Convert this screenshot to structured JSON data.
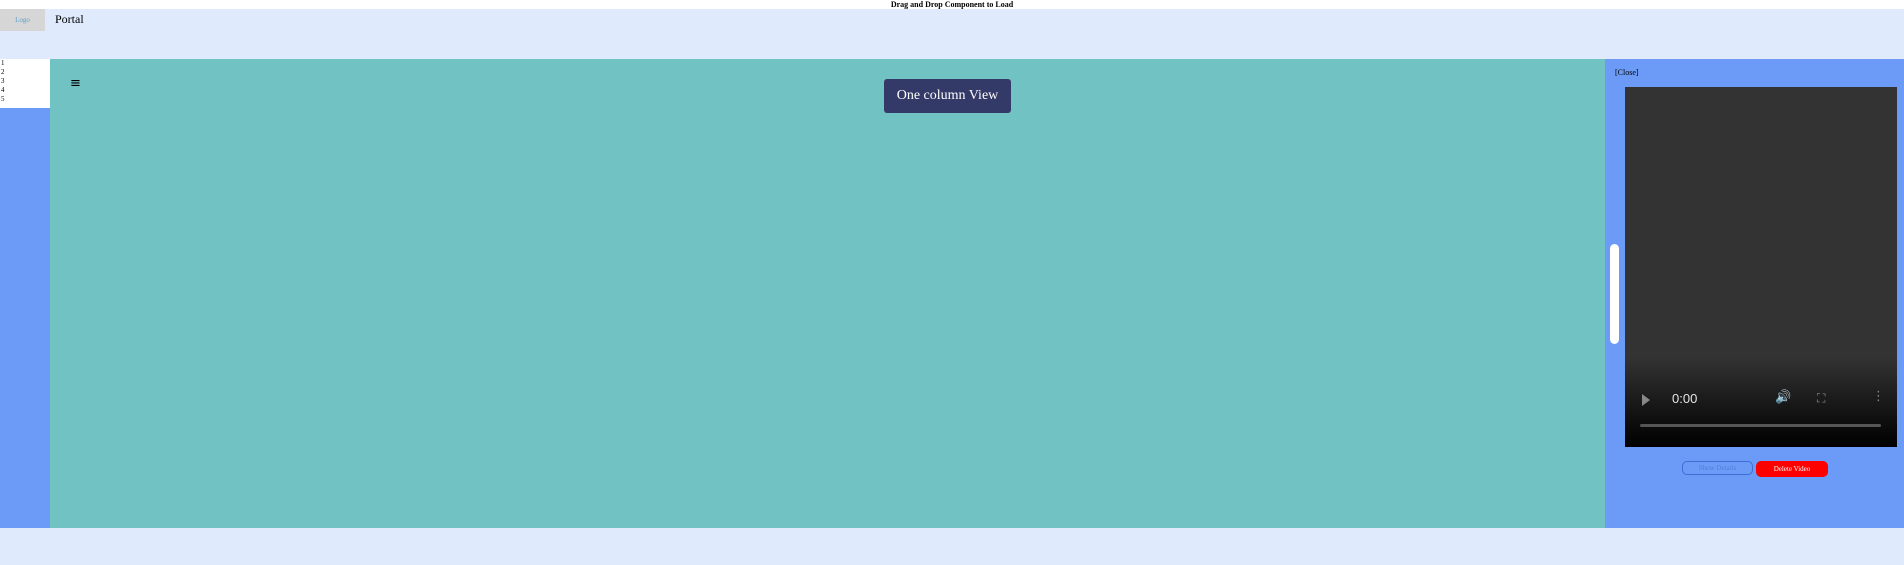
{
  "topbar": {
    "title": "Drag and Drop Component to Load"
  },
  "header": {
    "logo_text": "Logo",
    "title": "Portal"
  },
  "sidebar": {
    "items": [
      "1",
      "2",
      "3",
      "4",
      "5"
    ]
  },
  "main": {
    "menu_icon": "≡",
    "view_button_label": "One column View"
  },
  "right_panel": {
    "close_label": "[Close]",
    "video": {
      "time": "0:00",
      "play_icon": "play-icon",
      "volume_icon": "🔊",
      "fullscreen_icon": "⛶",
      "more_icon": "⋮",
      "progress": 0
    },
    "show_details_label": "Show Details",
    "delete_video_label": "Delete Video"
  },
  "colors": {
    "header_bg": "#dfebfd",
    "sidebar_bg": "#6b9bf6",
    "main_bg": "#71c2c2",
    "view_button_bg": "#343a68",
    "delete_button_bg": "#ff0000"
  }
}
